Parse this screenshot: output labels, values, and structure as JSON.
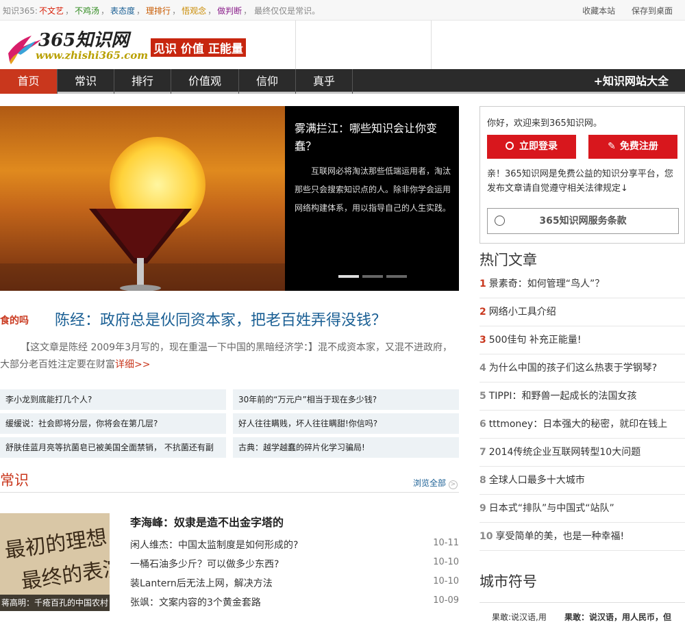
{
  "topbar": {
    "intro": "知识365:",
    "tags": [
      {
        "label": "不文艺",
        "color": "#d81e06"
      },
      {
        "label": "不鸡汤",
        "color": "#2f8a1e"
      },
      {
        "label": "表态度",
        "color": "#1a5f94"
      },
      {
        "label": "理排行",
        "color": "#c95a00"
      },
      {
        "label": "悟观念",
        "color": "#c98a00"
      },
      {
        "label": "做判断",
        "color": "#8a1e8a"
      }
    ],
    "tail": "最终仅仅是常识。",
    "links": [
      "收藏本站",
      "保存到桌面"
    ]
  },
  "header": {
    "logo_cn": "365知识网",
    "logo_en": "www.zhishi365.com",
    "slogan": "见识 价值 正能量"
  },
  "nav": {
    "items": [
      "首页",
      "常识",
      "排行",
      "价值观",
      "信仰",
      "真乎"
    ],
    "active": "首页",
    "more": "+知识网站大全"
  },
  "slider": {
    "title": "雾满拦江：哪些知识会让你变蠢？",
    "text": "互联网必将淘汰那些低端运用者，淘汰那些只会搜索知识点的人。除非你学会运用网络构建体系，用以指导自己的人生实践。",
    "dots": 3,
    "active_dot": 0
  },
  "headline": {
    "tag": "食的吗",
    "title": "陈经：政府总是伙同资本家，把老百姓弄得没钱？",
    "summary": "【这文章是陈经 2009年3月写的，现在重温一下中国的黑暗经济学：】混不成资本家，又混不进政府，大部分老百姓注定要在财富",
    "more": "详细>>"
  },
  "links": [
    "李小龙到底能打几个人?",
    "30年前的“万元户”相当于现在多少钱?",
    "缓缓说：社会即将分层，你将会在第几层?",
    "好人往往瞒贱，坏人往往瞒甜!你信吗?",
    "舒肤佳蓝月亮等抗菌皂已被美国全面禁销，  不抗菌还有副",
    "古典：越学越蠢的碎片化学习骗局!"
  ],
  "changshi": {
    "title": "常识",
    "browse": "浏览全部",
    "thumb_caption": "蒋高明：千疮百孔的中国农村",
    "thumb_art": [
      "最初的理想",
      "最终的表演"
    ],
    "lead": "李海峰：奴隶是造不出金字塔的",
    "items": [
      {
        "title": "闲人维杰：中国太监制度是如何形成的?",
        "date": "10-11"
      },
      {
        "title": "一桶石油多少斤？可以做多少东西?",
        "date": "10-10"
      },
      {
        "title": "装Lantern后无法上网，解决方法",
        "date": "10-10"
      },
      {
        "title": "张飒：文案内容的3个黄金套路",
        "date": "10-09"
      }
    ]
  },
  "login": {
    "greeting": "你好，欢迎来到365知识网。",
    "login_btn": "立即登录",
    "register_btn": "免费注册",
    "note": "亲！365知识网是免费公益的知识分享平台，您发布文章请自觉遵守相关法律规定↓",
    "service": "365知识网服务条款"
  },
  "hot": {
    "title": "热门文章",
    "items": [
      {
        "n": "1",
        "title": "景素奇：如何管理“鸟人”？",
        "red": true
      },
      {
        "n": "2",
        "title": "网络小工具介绍",
        "red": true
      },
      {
        "n": "3",
        "title": "500佳句 补充正能量!",
        "red": true
      },
      {
        "n": "4",
        "title": "为什么中国的孩子们这么热衷于学钢琴?",
        "red": false
      },
      {
        "n": "5",
        "title": "TIPPI：和野兽一起成长的法国女孩",
        "red": false
      },
      {
        "n": "6",
        "title": "tttmoney：日本强大的秘密，就印在钱上",
        "red": false
      },
      {
        "n": "7",
        "title": "2014传统企业互联网转型10大问题",
        "red": false
      },
      {
        "n": "8",
        "title": "全球人口最多十大城市",
        "red": false
      },
      {
        "n": "9",
        "title": "日本式“排队”与中国式“站队”",
        "red": false
      },
      {
        "n": "10",
        "title": "享受简单的美，也是一种幸福!",
        "red": false
      }
    ]
  },
  "city": {
    "title": "城市符号",
    "a": "果敢:说汉语,用",
    "b": "果敢：说汉语，用人民币，但"
  }
}
